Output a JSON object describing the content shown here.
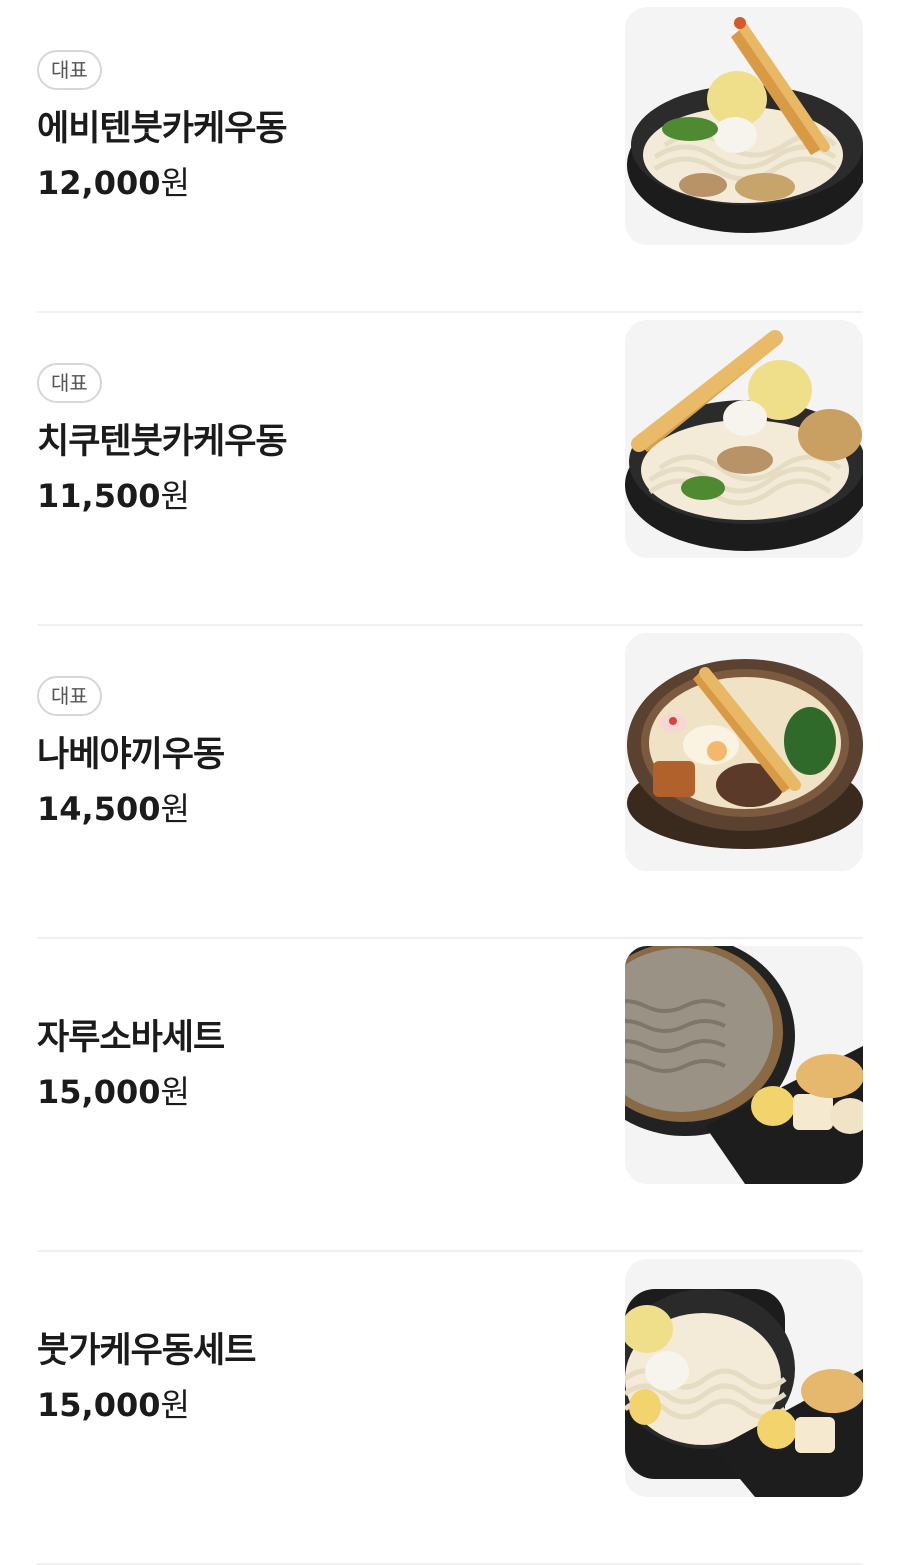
{
  "menu": {
    "items": [
      {
        "badge": "대표",
        "name": "에비텐붓카케우동",
        "price_number": "12,000",
        "price_unit": "원",
        "image_icon": "udon-shrimp-tempura-bowl-photo"
      },
      {
        "badge": "대표",
        "name": "치쿠텐붓카케우동",
        "price_number": "11,500",
        "price_unit": "원",
        "image_icon": "udon-fishcake-tempura-bowl-photo"
      },
      {
        "badge": "대표",
        "name": "나베야끼우동",
        "price_number": "14,500",
        "price_unit": "원",
        "image_icon": "nabeyaki-udon-clay-pot-photo"
      },
      {
        "name": "자루소바세트",
        "price_number": "15,000",
        "price_unit": "원",
        "image_icon": "zaru-soba-set-photo"
      },
      {
        "name": "붓가케우동세트",
        "price_number": "15,000",
        "price_unit": "원",
        "image_icon": "bukkake-udon-set-photo"
      }
    ]
  },
  "colors": {
    "text": "#1b1b1b",
    "badge_border": "#d6d6d6",
    "divider": "#f0f0f0",
    "thumb_bg": "#f4f4f4"
  }
}
